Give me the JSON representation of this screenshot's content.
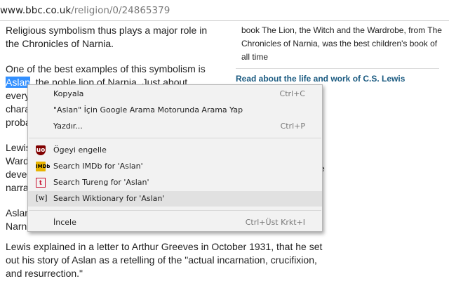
{
  "address_bar": {
    "host": "www.bbc.co.uk",
    "path": "/religion/0/24865379"
  },
  "article": {
    "para1": "Religious symbolism thus plays a major role in the Chronicles of Narnia.",
    "para2_selected": "Aslan",
    "para2_lead": "One of the best examples of this symbolism is",
    "para2_rest": ", the noble lion of Narnia. Just about",
    "para2_hidden_1": "every",
    "para2_hidden_2": "chara",
    "para2_hidden_3": "proba",
    "para3_1": "Lewis",
    "para3_2": "Ward",
    "para3_3": "deve",
    "para3_4": "narra",
    "para4_1": "Aslan",
    "para4_2": "Narn",
    "para5": "Lewis explained in a letter to Arthur Greeves in October 1931, that he set out his story of Aslan as a retelling of the \"actual incarnation, crucifixion, and resurrection.\""
  },
  "sidebar": {
    "text": "book The Lion, the Witch and the Wardrobe, from The Chronicles of Narnia, was the best children's book of all time",
    "link": "Read about the life and work of C.S. Lewis",
    "fragment": "e"
  },
  "context_menu": {
    "items": [
      {
        "label": "Kopyala",
        "shortcut": "Ctrl+C",
        "icon": null
      },
      {
        "label": "\"Aslan\" İçin Google Arama Motorunda Arama Yap",
        "shortcut": "",
        "icon": null
      },
      {
        "label": "Yazdır...",
        "shortcut": "Ctrl+P",
        "icon": null
      },
      {
        "label": "Ögeyi engelle",
        "shortcut": "",
        "icon": "ublock-icon",
        "icon_text": "uo"
      },
      {
        "label": "Search IMDb for 'Aslan'",
        "shortcut": "",
        "icon": "imdb-icon",
        "icon_text": "IMDb"
      },
      {
        "label": "Search Tureng for 'Aslan'",
        "shortcut": "",
        "icon": "tureng-icon",
        "icon_text": "t"
      },
      {
        "label": "Search Wiktionary for 'Aslan'",
        "shortcut": "",
        "icon": "wiktionary-icon",
        "icon_text": "[w]",
        "highlighted": true
      },
      {
        "label": "İncele",
        "shortcut": "Ctrl+Üst Krkt+I",
        "icon": null
      }
    ]
  },
  "colors": {
    "selection": "#3390ff",
    "link": "#1a5a80",
    "menu_background": "#f2f2f2",
    "menu_highlight": "#e1e1e1"
  }
}
